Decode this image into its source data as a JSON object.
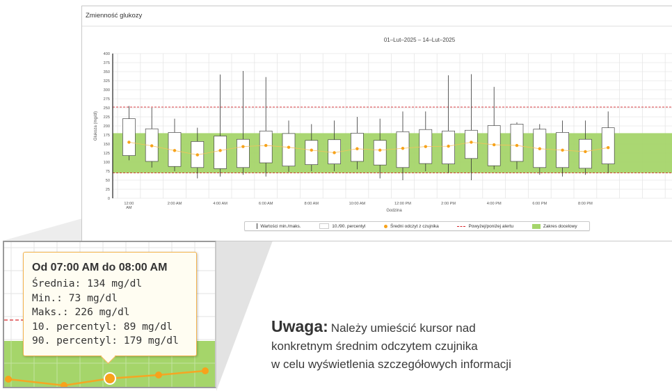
{
  "panel": {
    "title": "Zmienność glukozy",
    "date_range": "01–Lut–2025 – 14–Lut–2025"
  },
  "legend": {
    "min_max": "Wartości min./maks.",
    "percentile": "10./90. percentyl",
    "mean": "Średni odczyt z czujnika",
    "alert": "Powyżej/poniżej alertu",
    "target": "Zakres docelowy"
  },
  "colors": {
    "target_band": "#a5d56a",
    "alert_line": "#d6262b",
    "mean_dot": "#f7a21b",
    "tooltip_border": "#f3b34d"
  },
  "chart_data": {
    "type": "box",
    "title": "01–Lut–2025 – 14–Lut–2025",
    "xlabel": "Godzina",
    "ylabel": "Glukoza (mg/dl)",
    "ylim": [
      0,
      400
    ],
    "yticks": [
      0,
      25,
      50,
      75,
      100,
      125,
      150,
      175,
      200,
      225,
      250,
      275,
      300,
      325,
      350,
      375,
      400
    ],
    "xtick_labels": [
      "12:00 AM",
      "2:00 AM",
      "4:00 AM",
      "6:00 AM",
      "8:00 AM",
      "10:00 AM",
      "12:00 PM",
      "2:00 PM",
      "4:00 PM",
      "6:00 PM",
      "8:00 PM"
    ],
    "alert_high": 252,
    "alert_low": 70,
    "target_range": [
      70,
      180
    ],
    "grid": true,
    "legend_position": "bottom",
    "hours": [
      "12:00 AM",
      "1:00 AM",
      "2:00 AM",
      "3:00 AM",
      "4:00 AM",
      "5:00 AM",
      "6:00 AM",
      "7:00 AM",
      "8:00 AM",
      "9:00 AM",
      "10:00 AM",
      "11:00 AM",
      "12:00 PM",
      "1:00 PM",
      "2:00 PM",
      "3:00 PM",
      "4:00 PM",
      "5:00 PM",
      "6:00 PM",
      "7:00 PM",
      "8:00 PM",
      "9:00 PM"
    ],
    "min": [
      105,
      85,
      75,
      55,
      60,
      65,
      60,
      73,
      75,
      75,
      80,
      55,
      50,
      75,
      70,
      50,
      80,
      80,
      65,
      60,
      65,
      70
    ],
    "max": [
      255,
      250,
      220,
      195,
      342,
      352,
      335,
      215,
      205,
      215,
      225,
      220,
      240,
      240,
      340,
      343,
      308,
      210,
      205,
      215,
      215,
      240
    ],
    "p10": [
      118,
      102,
      88,
      85,
      82,
      85,
      98,
      89,
      93,
      95,
      102,
      92,
      85,
      96,
      95,
      110,
      90,
      102,
      85,
      85,
      83,
      95
    ],
    "p90": [
      220,
      192,
      182,
      157,
      172,
      163,
      186,
      179,
      160,
      162,
      180,
      160,
      184,
      190,
      186,
      188,
      201,
      205,
      191,
      182,
      163,
      195
    ],
    "mean": [
      155,
      145,
      132,
      120,
      132,
      143,
      146,
      141,
      133,
      126,
      137,
      133,
      138,
      143,
      144,
      155,
      148,
      146,
      137,
      133,
      129,
      140
    ]
  },
  "tooltip": {
    "title": "Od 07:00 AM do 08:00 AM",
    "lines": [
      "Średnia: 134 mg/dl",
      "Min.: 73 mg/dl",
      "Maks.: 226 mg/dl",
      "10. percentyl: 89 mg/dl",
      "90. percentyl: 179 mg/dl"
    ]
  },
  "note": {
    "label": "Uwaga:",
    "text_lines": [
      "Należy umieścić kursor nad",
      "konkretnym średnim odczytem czujnika",
      "w celu wyświetlenia szczegółowych informacji"
    ]
  }
}
